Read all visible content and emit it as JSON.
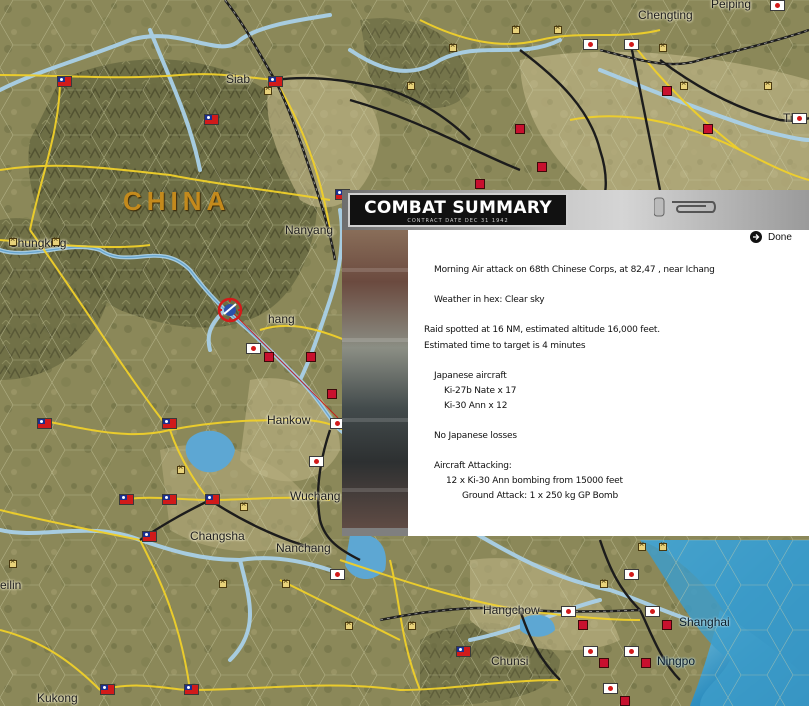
{
  "map": {
    "region_label": "CHINA",
    "cities": [
      {
        "name": "Siab"
      },
      {
        "name": "Nanyang"
      },
      {
        "name": "Chungking"
      },
      {
        "name": "hang"
      },
      {
        "name": "Hankow"
      },
      {
        "name": "Wuchang"
      },
      {
        "name": "Changsha"
      },
      {
        "name": "Nanchang"
      },
      {
        "name": "eilin"
      },
      {
        "name": "Kukong"
      },
      {
        "name": "Hangchow"
      },
      {
        "name": "Chunsi"
      },
      {
        "name": "Shanghai"
      },
      {
        "name": "Ningpo"
      },
      {
        "name": "Chengting"
      },
      {
        "name": "Peiping"
      },
      {
        "name": "Tien"
      }
    ]
  },
  "combat_summary": {
    "title": "COMBAT SUMMARY",
    "subtitle": "CONTRACT DATE DEC 31 1942",
    "done_label": "Done",
    "lines": [
      "Morning Air attack on 68th Chinese Corps, at 82,47 , near Ichang",
      "Weather in hex: Clear sky",
      "Raid spotted at 16 NM, estimated altitude 16,000 feet.",
      "Estimated time to target is 4 minutes",
      "Japanese aircraft",
      "Ki-27b Nate x 17",
      "Ki-30 Ann x 12",
      "No Japanese losses",
      "Aircraft Attacking:",
      "12 x Ki-30 Ann bombing from 15000 feet",
      "Ground Attack:  1 x 250 kg GP Bomb"
    ]
  },
  "colors": {
    "river": "#9fc6e0",
    "road": "#f1d12a",
    "rail": "#1b1b1b",
    "sea": "#2a83b5",
    "land": "#8c8a5c",
    "roc_flag": "#d11a1a",
    "japan_unit": "#c8102e"
  }
}
